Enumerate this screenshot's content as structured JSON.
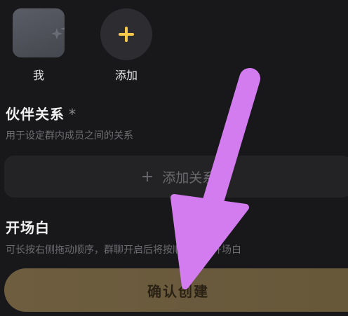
{
  "members": {
    "me_label": "我",
    "add_label": "添加"
  },
  "partner": {
    "title": "伙伴关系",
    "required_mark": "*",
    "desc": "用于设定群内成员之间的关系",
    "add_button_label": "添加关系"
  },
  "opening": {
    "title": "开场白",
    "desc": "可长按右侧拖动顺序，群聊开启后将按顺序展示开场白"
  },
  "confirm_label": "确认创建",
  "colors": {
    "background": "#18181a",
    "accent_yellow": "#f5c84c",
    "arrow_purple": "#d27cf0",
    "confirm_bg": "#6e5d3e"
  },
  "icons": {
    "avatar": "sparkle-icon",
    "add": "plus-icon",
    "add_relation": "plus-icon",
    "annotation": "arrow-down-icon"
  }
}
